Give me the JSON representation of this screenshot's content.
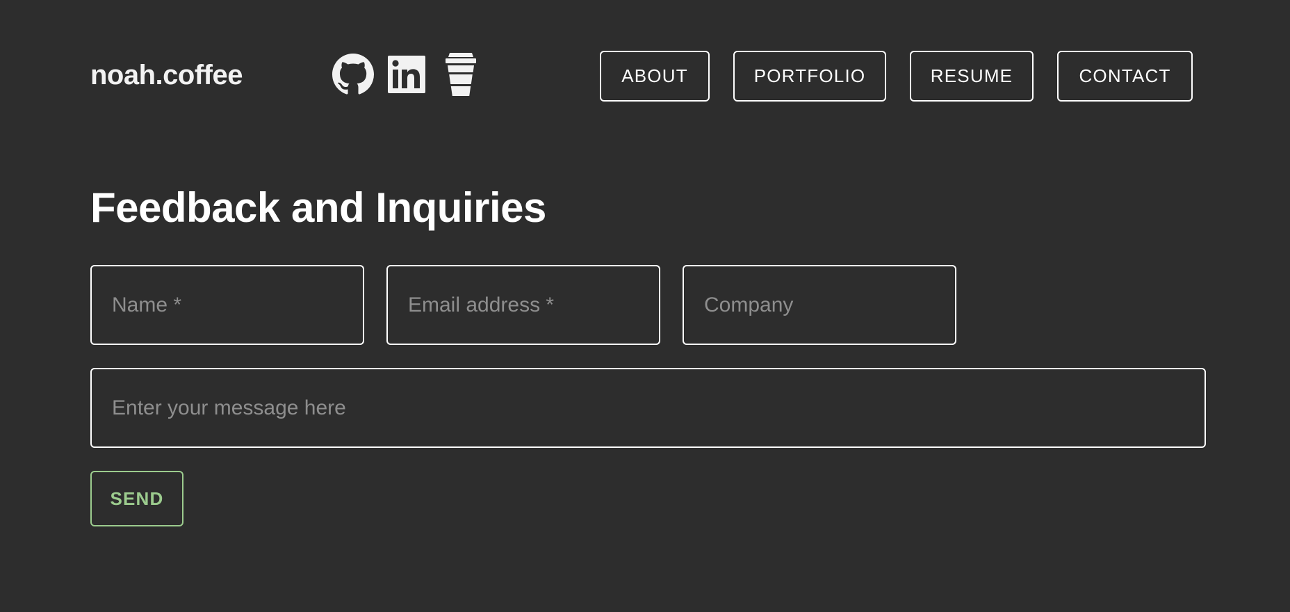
{
  "header": {
    "brand": "noah.coffee",
    "socials": [
      {
        "icon": "github-icon",
        "label": "GitHub"
      },
      {
        "icon": "linkedin-icon",
        "label": "LinkedIn"
      },
      {
        "icon": "coffee-cup-icon",
        "label": "Buy me a coffee"
      }
    ],
    "nav": {
      "about": "ABOUT",
      "portfolio": "PORTFOLIO",
      "resume": "RESUME",
      "contact": "CONTACT"
    }
  },
  "main": {
    "title": "Feedback and Inquiries",
    "form": {
      "name": {
        "value": "",
        "placeholder": "Name *"
      },
      "email": {
        "value": "",
        "placeholder": "Email address *"
      },
      "company": {
        "value": "",
        "placeholder": "Company"
      },
      "message": {
        "value": "",
        "placeholder": "Enter your message here"
      },
      "send_label": "SEND"
    }
  },
  "colors": {
    "background": "#2d2d2d",
    "text": "#ffffff",
    "placeholder": "#8e8e8e",
    "accent_send": "#9ccc8e"
  }
}
